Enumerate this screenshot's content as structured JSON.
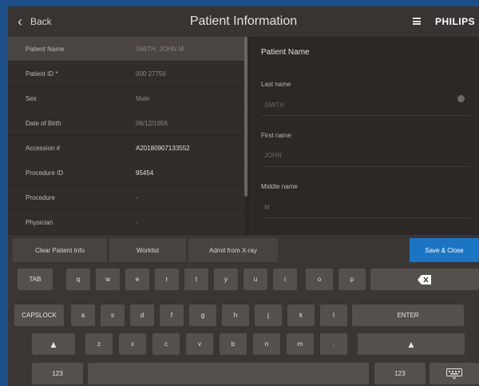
{
  "header": {
    "back_label": "Back",
    "title": "Patient Information",
    "brand": "PHILIPS"
  },
  "left_list": {
    "rows": [
      {
        "label": "Patient Name",
        "value": "SMITH, JOHN M"
      },
      {
        "label": "Patient ID *",
        "value": "000 27756"
      },
      {
        "label": "Sex",
        "value": "Male"
      },
      {
        "label": "Date of Birth",
        "value": "06/12/1956"
      },
      {
        "label": "Accession #",
        "value": "A20180907133552"
      },
      {
        "label": "Procedure ID",
        "value": "95454"
      },
      {
        "label": "Procedure",
        "value": "-"
      },
      {
        "label": "Physician",
        "value": "-"
      }
    ]
  },
  "right_panel": {
    "title": "Patient Name",
    "last_name_label": "Last name",
    "last_name_value": "SMITH",
    "first_name_label": "First name",
    "first_name_value": "JOHN",
    "middle_name_label": "Middle name",
    "middle_name_value": "M"
  },
  "actions": {
    "clear": "Clear Patient Info",
    "worklist": "Worklist",
    "admit": "Admit from X-ray",
    "save": "Save & Close"
  },
  "keyboard": {
    "row1": [
      "TAB",
      "q",
      "w",
      "e",
      "r",
      "t",
      "y",
      "u",
      "i",
      "o",
      "p"
    ],
    "row2": [
      "CAPSLOCK",
      "a",
      "s",
      "d",
      "f",
      "g",
      "h",
      "j",
      "k",
      "l",
      "ENTER"
    ],
    "row3": [
      "z",
      "x",
      "c",
      "v",
      "b",
      "n",
      "m",
      "."
    ],
    "row4": [
      "123",
      "123"
    ]
  },
  "colors": {
    "accent": "#1b75c4",
    "background": "#2a2624",
    "frame": "#1c4f8a"
  }
}
